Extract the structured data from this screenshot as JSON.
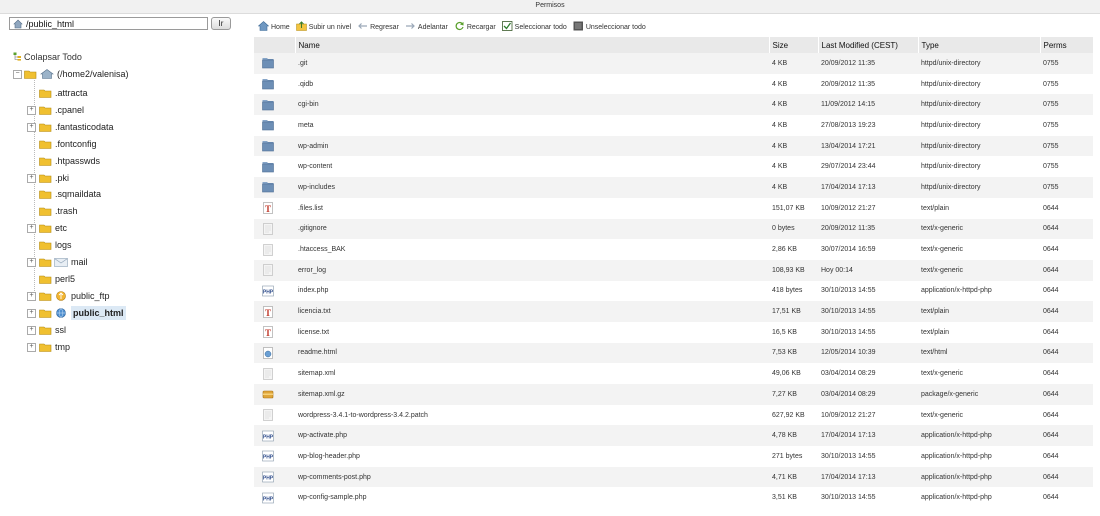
{
  "window": {
    "title": "Permisos"
  },
  "path_bar": {
    "value": "/public_html",
    "go_label": "Ir"
  },
  "tree": {
    "collapse_label": "Colapsar Todo",
    "root": "(/home2/valenisa)",
    "items": [
      {
        "label": ".attracta",
        "expandable": false
      },
      {
        "label": ".cpanel",
        "expandable": true
      },
      {
        "label": ".fantasticodata",
        "expandable": true
      },
      {
        "label": ".fontconfig",
        "expandable": false
      },
      {
        "label": ".htpasswds",
        "expandable": false
      },
      {
        "label": ".pki",
        "expandable": true
      },
      {
        "label": ".sqmaildata",
        "expandable": false
      },
      {
        "label": ".trash",
        "expandable": false
      },
      {
        "label": "etc",
        "expandable": true
      },
      {
        "label": "logs",
        "expandable": false
      },
      {
        "label": "mail",
        "expandable": true,
        "icon": "mail-icon"
      },
      {
        "label": "perl5",
        "expandable": false
      },
      {
        "label": "public_ftp",
        "expandable": true,
        "icon": "ftp-icon"
      },
      {
        "label": "public_html",
        "expandable": true,
        "icon": "globe-icon",
        "selected": true
      },
      {
        "label": "ssl",
        "expandable": true
      },
      {
        "label": "tmp",
        "expandable": true
      }
    ]
  },
  "toolbar": {
    "items": [
      {
        "label": "Home",
        "icon": "home-icon"
      },
      {
        "label": "Subir un nivel",
        "icon": "up-level-icon"
      },
      {
        "label": "Regresar",
        "icon": "back-arrow-icon"
      },
      {
        "label": "Adelantar",
        "icon": "forward-arrow-icon"
      },
      {
        "label": "Recargar",
        "icon": "reload-icon"
      },
      {
        "label": "Seleccionar todo",
        "icon": "checkbox-checked-icon"
      },
      {
        "label": "Unseleccionar todo",
        "icon": "checkbox-empty-icon"
      }
    ]
  },
  "table": {
    "columns": [
      "Name",
      "Size",
      "Last Modified (CEST)",
      "Type",
      "Perms"
    ],
    "rows": [
      {
        "icon": "folder-icon",
        "name": ".git",
        "size": "4 KB",
        "modified": "20/09/2012 11:35",
        "type": "httpd/unix-directory",
        "perms": "0755"
      },
      {
        "icon": "folder-icon",
        "name": ".qidb",
        "size": "4 KB",
        "modified": "20/09/2012 11:35",
        "type": "httpd/unix-directory",
        "perms": "0755"
      },
      {
        "icon": "folder-icon",
        "name": "cgi-bin",
        "size": "4 KB",
        "modified": "11/09/2012 14:15",
        "type": "httpd/unix-directory",
        "perms": "0755"
      },
      {
        "icon": "folder-icon",
        "name": "meta",
        "size": "4 KB",
        "modified": "27/08/2013 19:23",
        "type": "httpd/unix-directory",
        "perms": "0755"
      },
      {
        "icon": "folder-icon",
        "name": "wp-admin",
        "size": "4 KB",
        "modified": "13/04/2014 17:21",
        "type": "httpd/unix-directory",
        "perms": "0755"
      },
      {
        "icon": "folder-icon",
        "name": "wp-content",
        "size": "4 KB",
        "modified": "29/07/2014 23:44",
        "type": "httpd/unix-directory",
        "perms": "0755"
      },
      {
        "icon": "folder-icon",
        "name": "wp-includes",
        "size": "4 KB",
        "modified": "17/04/2014 17:13",
        "type": "httpd/unix-directory",
        "perms": "0755"
      },
      {
        "icon": "text-file-icon",
        "name": ".files.list",
        "size": "151,07 KB",
        "modified": "10/09/2012 21:27",
        "type": "text/plain",
        "perms": "0644"
      },
      {
        "icon": "generic-file-icon",
        "name": ".gitignore",
        "size": "0 bytes",
        "modified": "20/09/2012 11:35",
        "type": "text/x-generic",
        "perms": "0644"
      },
      {
        "icon": "generic-file-icon",
        "name": ".htaccess_BAK",
        "size": "2,86 KB",
        "modified": "30/07/2014 16:59",
        "type": "text/x-generic",
        "perms": "0644"
      },
      {
        "icon": "generic-file-icon",
        "name": "error_log",
        "size": "108,93 KB",
        "modified": "Hoy 00:14",
        "type": "text/x-generic",
        "perms": "0644"
      },
      {
        "icon": "php-file-icon",
        "name": "index.php",
        "size": "418 bytes",
        "modified": "30/10/2013 14:55",
        "type": "application/x-httpd-php",
        "perms": "0644"
      },
      {
        "icon": "text-file-icon",
        "name": "licencia.txt",
        "size": "17,51 KB",
        "modified": "30/10/2013 14:55",
        "type": "text/plain",
        "perms": "0644"
      },
      {
        "icon": "text-file-icon",
        "name": "license.txt",
        "size": "16,5 KB",
        "modified": "30/10/2013 14:55",
        "type": "text/plain",
        "perms": "0644"
      },
      {
        "icon": "html-file-icon",
        "name": "readme.html",
        "size": "7,53 KB",
        "modified": "12/05/2014 10:39",
        "type": "text/html",
        "perms": "0644"
      },
      {
        "icon": "generic-file-icon",
        "name": "sitemap.xml",
        "size": "49,06 KB",
        "modified": "03/04/2014 08:29",
        "type": "text/x-generic",
        "perms": "0644"
      },
      {
        "icon": "package-file-icon",
        "name": "sitemap.xml.gz",
        "size": "7,27 KB",
        "modified": "03/04/2014 08:29",
        "type": "package/x-generic",
        "perms": "0644"
      },
      {
        "icon": "generic-file-icon",
        "name": "wordpress-3.4.1-to-wordpress-3.4.2.patch",
        "size": "627,92 KB",
        "modified": "10/09/2012 21:27",
        "type": "text/x-generic",
        "perms": "0644"
      },
      {
        "icon": "php-file-icon",
        "name": "wp-activate.php",
        "size": "4,78 KB",
        "modified": "17/04/2014 17:13",
        "type": "application/x-httpd-php",
        "perms": "0644"
      },
      {
        "icon": "php-file-icon",
        "name": "wp-blog-header.php",
        "size": "271 bytes",
        "modified": "30/10/2013 14:55",
        "type": "application/x-httpd-php",
        "perms": "0644"
      },
      {
        "icon": "php-file-icon",
        "name": "wp-comments-post.php",
        "size": "4,71 KB",
        "modified": "17/04/2014 17:13",
        "type": "application/x-httpd-php",
        "perms": "0644"
      },
      {
        "icon": "php-file-icon",
        "name": "wp-config-sample.php",
        "size": "3,51 KB",
        "modified": "30/10/2013 14:55",
        "type": "application/x-httpd-php",
        "perms": "0644"
      }
    ]
  }
}
